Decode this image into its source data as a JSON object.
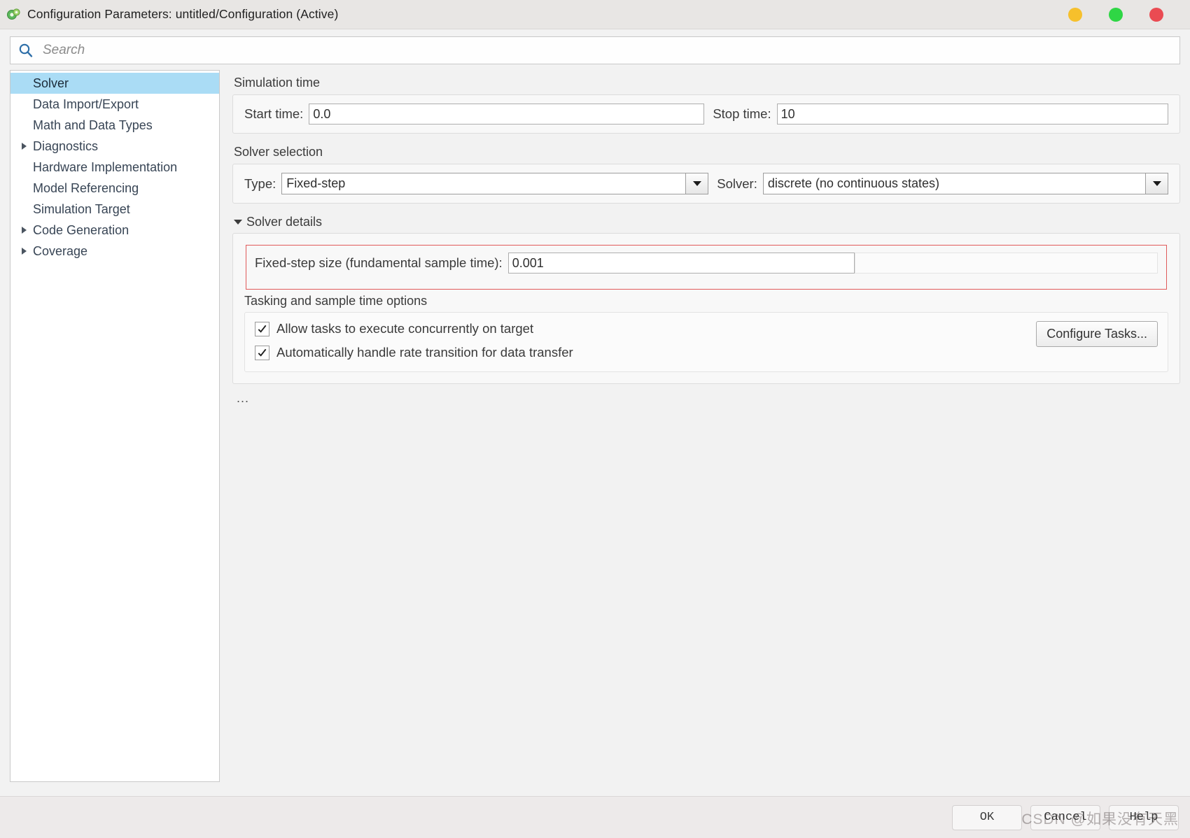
{
  "window": {
    "title": "Configuration Parameters: untitled/Configuration (Active)",
    "app_icon": "simulink-gear-icon",
    "controls": [
      {
        "name": "minimize",
        "color": "#f6c02c"
      },
      {
        "name": "maximize",
        "color": "#2fd645"
      },
      {
        "name": "close",
        "color": "#ea4b52"
      }
    ]
  },
  "search": {
    "icon": "search-icon",
    "value": "",
    "placeholder": "Search"
  },
  "sidebar": {
    "items": [
      {
        "label": "Solver",
        "expandable": false,
        "selected": true
      },
      {
        "label": "Data Import/Export",
        "expandable": false,
        "selected": false
      },
      {
        "label": "Math and Data Types",
        "expandable": false,
        "selected": false
      },
      {
        "label": "Diagnostics",
        "expandable": true,
        "selected": false
      },
      {
        "label": "Hardware Implementation",
        "expandable": false,
        "selected": false
      },
      {
        "label": "Model Referencing",
        "expandable": false,
        "selected": false
      },
      {
        "label": "Simulation Target",
        "expandable": false,
        "selected": false
      },
      {
        "label": "Code Generation",
        "expandable": true,
        "selected": false
      },
      {
        "label": "Coverage",
        "expandable": true,
        "selected": false
      }
    ]
  },
  "main": {
    "simulation_time": {
      "title": "Simulation time",
      "start_time_label": "Start time:",
      "start_time_value": "0.0",
      "stop_time_label": "Stop time:",
      "stop_time_value": "10"
    },
    "solver_selection": {
      "title": "Solver selection",
      "type_label": "Type:",
      "type_value": "Fixed-step",
      "solver_label": "Solver:",
      "solver_value": "discrete (no continuous states)"
    },
    "solver_details": {
      "title": "Solver details",
      "expanded": true,
      "fixed_step_label": "Fixed-step size (fundamental sample time):",
      "fixed_step_value": "0.001",
      "highlight_color": "#e05a5a",
      "tasking_title": "Tasking and sample time options",
      "checkboxes": [
        {
          "label": "Allow tasks to execute concurrently on target",
          "checked": true
        },
        {
          "label": "Automatically handle rate transition for data transfer",
          "checked": true
        }
      ],
      "configure_tasks_label": "Configure Tasks..."
    },
    "overflow_indicator": "..."
  },
  "footer": {
    "buttons": [
      {
        "label": "OK",
        "name": "ok-button"
      },
      {
        "label": "Cancel",
        "name": "cancel-button"
      },
      {
        "label": "Help",
        "name": "help-button"
      }
    ],
    "watermark": "CSDN @如果没有天黑"
  }
}
